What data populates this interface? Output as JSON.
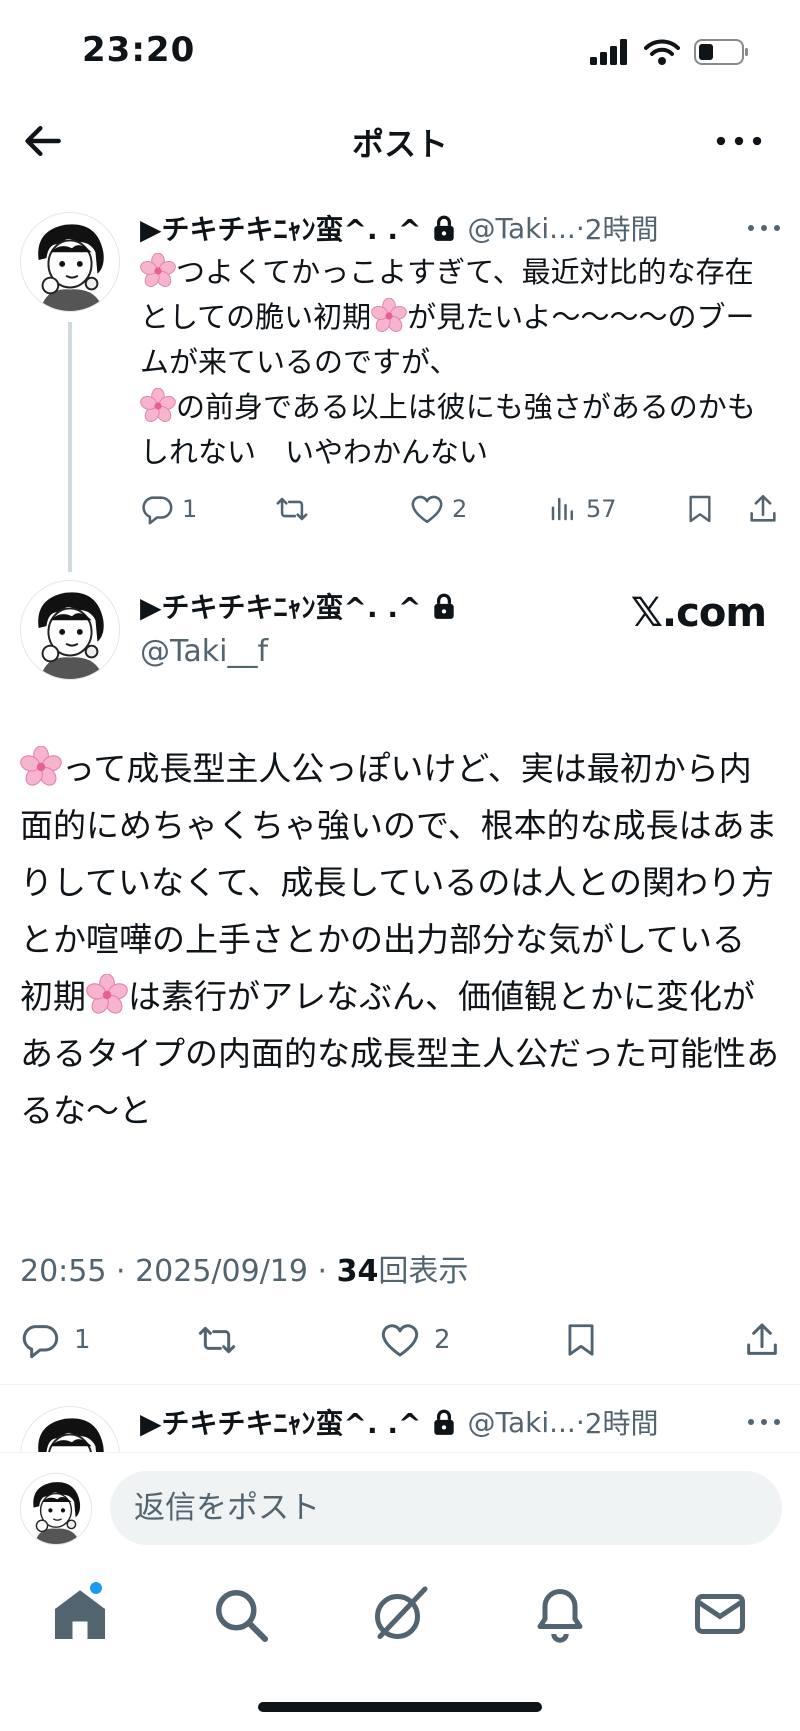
{
  "status_bar": {
    "time": "23:20"
  },
  "nav": {
    "title": "ポスト"
  },
  "reply_post": {
    "display_name": "▶チキチキﾆｬﾝ蛮^. .^",
    "handle": "@Taki...",
    "time": "2時間",
    "text_parts": [
      "つよくてかっこよすぎて、最近対比的な存在としての脆い初期",
      "が見たいよ〜〜〜〜のブームが来ているのですが、",
      "の前身である以上は彼にも強さがあるのかもしれない　いやわかんない"
    ],
    "reply_count": "1",
    "like_count": "2",
    "view_count": "57"
  },
  "main_post": {
    "display_name": "▶チキチキﾆｬﾝ蛮^. .^",
    "handle": "@Taki__f",
    "source": "𝕏.com",
    "text_parts": [
      "って成長型主人公っぽいけど、実は最初から内面的にめちゃくちゃ強いので、根本的な成長はあまりしていなくて、成長しているのは人との関わり方とか喧嘩の上手さとかの出力部分な気がしている",
      "初期",
      "は素行がアレなぶん、価値観とかに変化があるタイプの内面的な成長型主人公だった可能性あるな〜と"
    ],
    "timestamp": "20:55 · 2025/09/19 · ",
    "views_number": "34",
    "views_label": "回表示",
    "reply_count": "1",
    "like_count": "2"
  },
  "next_post": {
    "display_name": "▶チキチキﾆｬﾝ蛮^. .^",
    "handle": "@Taki...",
    "time": "2時間"
  },
  "composer": {
    "placeholder": "返信をポスト"
  },
  "tabbar": {
    "items": [
      "home-icon",
      "search-icon",
      "grok-icon",
      "notifications-icon",
      "messages-icon"
    ]
  },
  "colors": {
    "accent": "#1d9bf0",
    "text": "#0f1419",
    "secondary": "#536471",
    "flower": "#f4a6c8"
  }
}
